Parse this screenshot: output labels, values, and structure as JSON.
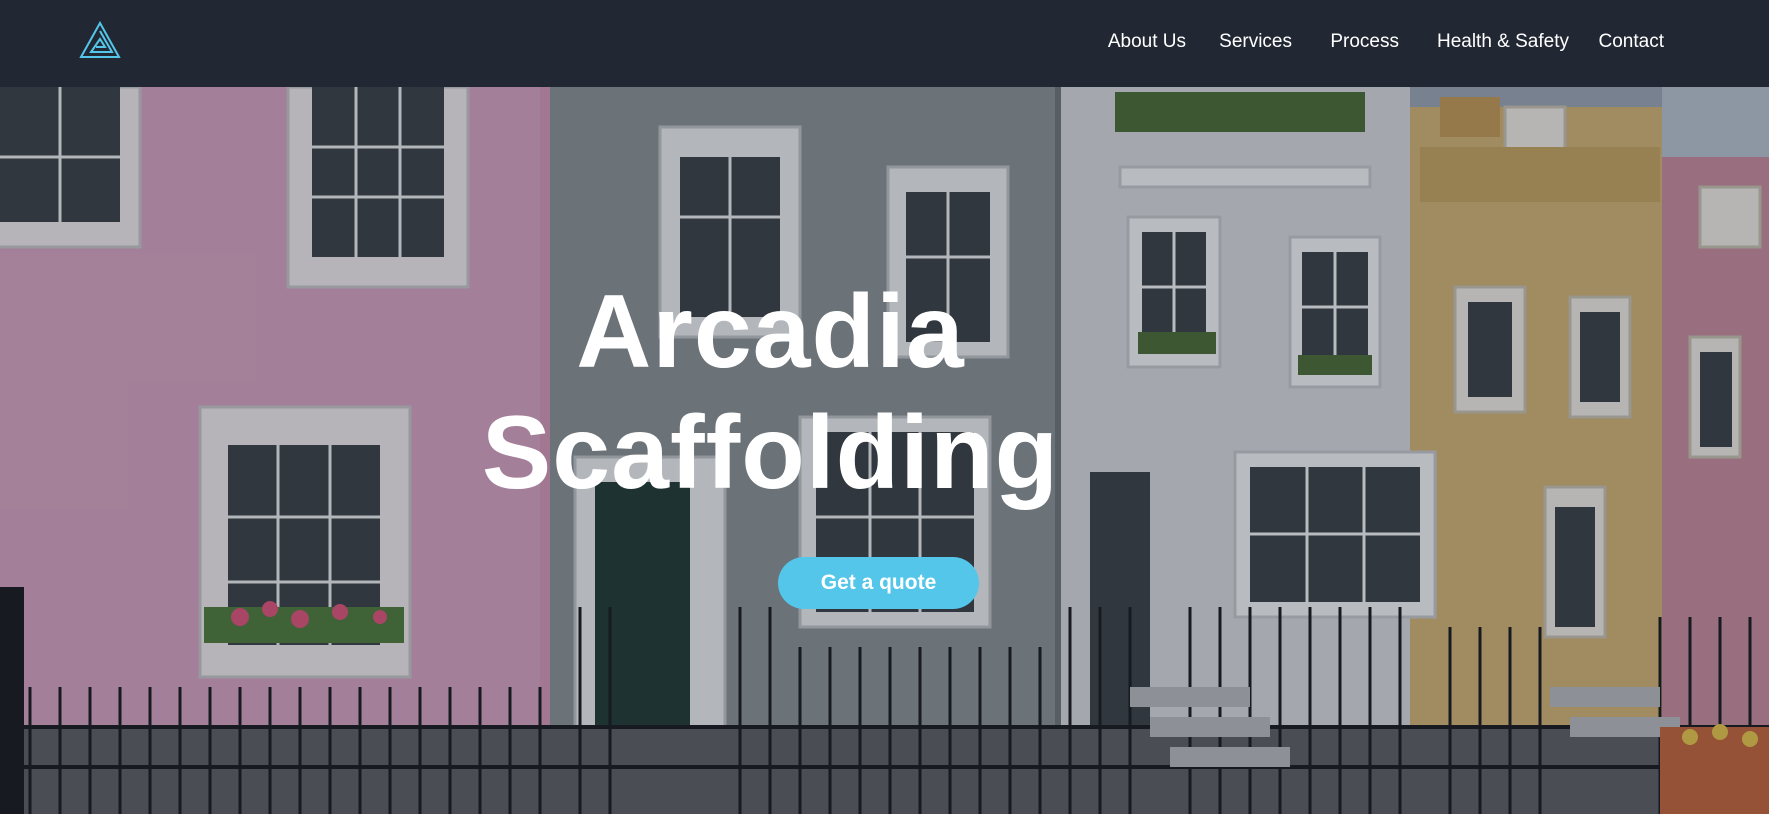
{
  "brand": {
    "logo_icon": "triangle-logo-icon",
    "accent_color": "#53c6ea"
  },
  "nav": {
    "items": [
      {
        "label": "About Us"
      },
      {
        "label": "Services"
      },
      {
        "label": "Process"
      },
      {
        "label": "Health & Safety"
      },
      {
        "label": "Contact"
      }
    ]
  },
  "hero": {
    "title_line_1": "Arcadia",
    "title_line_2": "Scaffolding",
    "cta_label": "Get a quote",
    "background": "row-of-colourful-terraced-houses-photo"
  },
  "colors": {
    "nav_bg": "#222833",
    "text": "#ffffff",
    "cta_bg": "#53c6ea"
  }
}
